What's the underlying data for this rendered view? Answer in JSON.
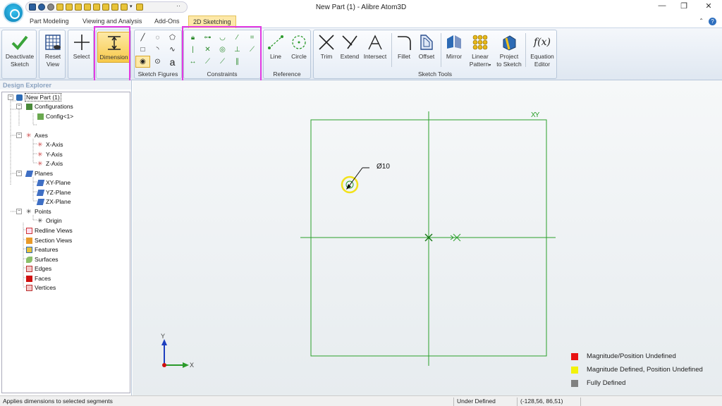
{
  "window": {
    "title": "New Part (1) - Alibre Atom3D"
  },
  "tabs": [
    {
      "label": "Part Modeling"
    },
    {
      "label": "Viewing and Analysis"
    },
    {
      "label": "Add-Ons"
    },
    {
      "label": "2D Sketching"
    }
  ],
  "ribbon": {
    "deactivate": "Deactivate Sketch",
    "deactivate_l1": "Deactivate",
    "deactivate_l2": "Sketch",
    "reset_l1": "Reset",
    "reset_l2": "View",
    "select": "Select",
    "dimension": "Dimension",
    "groups": {
      "sketch_figures": "Sketch Figures",
      "constraints": "Constraints",
      "reference": "Reference",
      "sketch_tools": "Sketch Tools"
    },
    "line": "Line",
    "circle": "Circle",
    "trim": "Trim",
    "extend": "Extend",
    "intersect": "Intersect",
    "fillet": "Fillet",
    "offset": "Offset",
    "mirror": "Mirror",
    "linear_l1": "Linear",
    "linear_l2": "Pattern",
    "project_l1": "Project",
    "project_l2": "to Sketch",
    "equation_glyph": "f(x)",
    "equation_l1": "Equation",
    "equation_l2": "Editor",
    "text_glyph": "a"
  },
  "design_explorer": {
    "title": "Design Explorer",
    "nodes": [
      {
        "label": "New Part (1)"
      },
      {
        "label": "Configurations"
      },
      {
        "label": "Config<1>"
      },
      {
        "label": "Axes"
      },
      {
        "label": "X-Axis"
      },
      {
        "label": "Y-Axis"
      },
      {
        "label": "Z-Axis"
      },
      {
        "label": "Planes"
      },
      {
        "label": "XY-Plane"
      },
      {
        "label": "YZ-Plane"
      },
      {
        "label": "ZX-Plane"
      },
      {
        "label": "Points"
      },
      {
        "label": "Origin"
      },
      {
        "label": "Redline Views"
      },
      {
        "label": "Section Views"
      },
      {
        "label": "Features"
      },
      {
        "label": "Surfaces"
      },
      {
        "label": "Edges"
      },
      {
        "label": "Faces"
      },
      {
        "label": "Vertices"
      }
    ]
  },
  "canvas": {
    "dimension_label": "Ø10",
    "triad_y": "Y",
    "triad_x": "X",
    "plane_marker": "XY"
  },
  "legend": [
    {
      "label": "Magnitude/Position Undefined",
      "color": "#e81212"
    },
    {
      "label": "Magnitude Defined, Position Undefined",
      "color": "#f2f20a"
    },
    {
      "label": "Fully Defined",
      "color": "#808080"
    }
  ],
  "status": {
    "hint": "Applies dimensions to selected segments",
    "state": "Under Defined",
    "coords": "(-128,56, 86,51)"
  }
}
